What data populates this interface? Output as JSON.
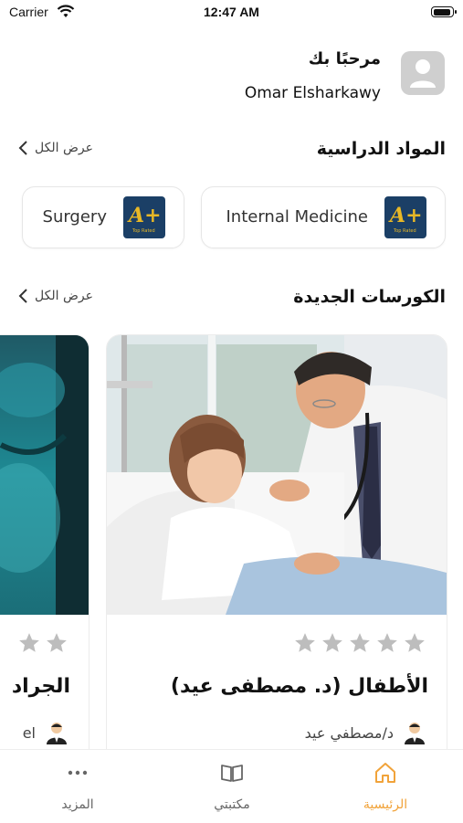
{
  "status_bar": {
    "carrier": "Carrier",
    "time": "12:47 AM",
    "battery_level": 0.95
  },
  "header": {
    "greeting": "مرحبًا بك",
    "user_name": "Omar Elsharkawy"
  },
  "subjects_section": {
    "title": "المواد الدراسية",
    "view_all": "عرض الكل",
    "items": [
      {
        "name": "Internal Medicine",
        "logo_text": "A+"
      },
      {
        "name": "Surgery",
        "logo_text": "A+"
      }
    ]
  },
  "courses_section": {
    "title": "الكورسات الجديدة",
    "view_all": "عرض الكل",
    "courses": [
      {
        "title": "الأطفال (د. مصطفى عيد)",
        "instructor": "د/مصطفي عيد",
        "rating": 0
      },
      {
        "title": "الجراد",
        "instructor": "el",
        "rating": 0
      }
    ]
  },
  "tab_bar": {
    "tabs": [
      {
        "label": "الرئيسية",
        "icon": "home-icon",
        "active": true
      },
      {
        "label": "مكتبتي",
        "icon": "book-icon",
        "active": false
      },
      {
        "label": "المزيد",
        "icon": "more-icon",
        "active": false
      }
    ]
  },
  "colors": {
    "accent": "#f1a33a",
    "star_empty": "#bdbdbd",
    "logo_bg": "#1b3f66",
    "logo_text": "#e8b826"
  }
}
